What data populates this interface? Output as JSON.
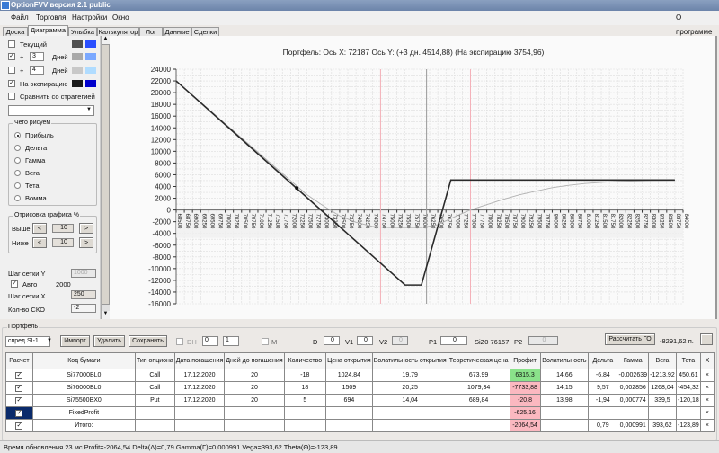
{
  "window": {
    "title": "OptionFVV версия 2.1 public"
  },
  "menu": [
    "Файл",
    "Торговля",
    "Настройки",
    "Окно"
  ],
  "menu_right": "О программе",
  "tabs": [
    "Доска",
    "Диаграмма",
    "Улыбка",
    "Калькулятор",
    "Лог",
    "Данные",
    "Сделки"
  ],
  "active_tab": "Диаграмма",
  "left_panel": {
    "current": {
      "label": "Текущий",
      "checked": false,
      "colors": [
        "#505050",
        "#2a4fff"
      ]
    },
    "plus1": {
      "prefix": "+",
      "days": "3",
      "unit": "Дней",
      "checked": true,
      "colors": [
        "#a8a8a8",
        "#7aa8ff"
      ]
    },
    "plus2": {
      "prefix": "+",
      "days": "4",
      "unit": "Дней",
      "checked": false,
      "colors": [
        "#c8c8c8",
        "#b0dcff"
      ]
    },
    "expiry": {
      "label": "На экспирацию",
      "checked": true,
      "colors": [
        "#1a1a1a",
        "#0000cc"
      ]
    },
    "compare": {
      "label": "Сравнить со стратегией",
      "checked": false
    },
    "strategy_select": "",
    "draw_group": {
      "title": "Чего рисуем",
      "options": [
        "Прибыль",
        "Дельта",
        "Гамма",
        "Вега",
        "Тета",
        "Вомма"
      ],
      "selected": "Прибыль"
    },
    "range_group": {
      "title": "Отрисовка графика %",
      "above_label": "Выше",
      "above": "10",
      "below_label": "Ниже",
      "below": "10",
      "dec": "<",
      "inc": ">"
    },
    "grid_y_label": "Шаг сетки Y",
    "grid_y": "1000",
    "auto_label": "Авто",
    "auto_checked": true,
    "auto_value": "2000",
    "grid_x_label": "Шаг сетки X",
    "grid_x": "250",
    "sko_label": "Кол-во СКО",
    "sko": "-2"
  },
  "chart_data": {
    "type": "line",
    "title": "Портфель: Ось X: 72187 Ось Y:  (+3 дн. 4514,88)  (На экспирацию 3754,96)",
    "xlim": [
      68500,
      84000
    ],
    "xtick_step": 250,
    "ylim": [
      -16000,
      24000
    ],
    "ytick_step": 2000,
    "grid": true,
    "series": [
      {
        "color": "#b0b0b0",
        "points": [
          [
            68500,
            22000
          ],
          [
            72000,
            5000
          ],
          [
            72500,
            2600
          ],
          [
            73000,
            700
          ],
          [
            73500,
            -1000
          ],
          [
            74000,
            -2100
          ],
          [
            74500,
            -2800
          ],
          [
            75000,
            -3000
          ],
          [
            75500,
            -3000
          ],
          [
            76000,
            -3000
          ],
          [
            76500,
            -2500
          ],
          [
            77000,
            -1200
          ],
          [
            77500,
            0
          ],
          [
            78000,
            900
          ],
          [
            78500,
            1800
          ],
          [
            79000,
            2600
          ],
          [
            79500,
            3200
          ],
          [
            80000,
            3800
          ],
          [
            80500,
            4200
          ],
          [
            81000,
            4500
          ],
          [
            81500,
            4700
          ],
          [
            82000,
            4850
          ],
          [
            83000,
            5000
          ],
          [
            83750,
            5050
          ]
        ]
      },
      {
        "color": "#2a2a2a",
        "points": [
          [
            68500,
            22000
          ],
          [
            75500,
            -12800
          ],
          [
            76000,
            -12800
          ],
          [
            76900,
            5100
          ],
          [
            83750,
            5100
          ]
        ]
      }
    ],
    "vlines": [
      {
        "x": 74750,
        "color": "#f4b0b8"
      },
      {
        "x": 77500,
        "color": "#f4b0b8"
      },
      {
        "x": 76157,
        "color": "#999999"
      }
    ],
    "marker": {
      "x": 72187,
      "y": 3754.96
    }
  },
  "portfolio": {
    "title": "Портфель",
    "select": "спред SI-1",
    "import": "Импорт",
    "delete": "Удалить",
    "save": "Сохранить",
    "dh_label": "DH",
    "spin1": "0",
    "spin2": "1",
    "m_label": "M",
    "d_label": "D",
    "d": "0",
    "v1_label": "V1",
    "v1": "0",
    "v2_label": "V2",
    "v2": "0",
    "p1_label": "P1",
    "p1": "0",
    "future": "SiZ0 76157",
    "p2_label": "P2",
    "p2": "0",
    "calc_go": "Рассчитать ГО",
    "go_value": "-8291,62 п.",
    "minimize": "_",
    "columns": [
      "Расчет",
      "Код бумаги",
      "Тип опциона",
      "Дата погашения",
      "Дней до погашения",
      "Количество",
      "Цена открытия",
      "Волатильность открытия",
      "Теоретическая цена",
      "Профит",
      "Волатильность",
      "Дельта",
      "Гамма",
      "Вега",
      "Тета",
      "X"
    ],
    "rows": [
      [
        "✓",
        "Si77000BL0",
        "Call",
        "17.12.2020",
        "20",
        "-18",
        "1024,84",
        "19,79",
        "673,99",
        "6315,3",
        "14,66",
        "-6,84",
        "-0,002639",
        "-1213,92",
        "450,61",
        "×"
      ],
      [
        "✓",
        "Si76000BL0",
        "Call",
        "17.12.2020",
        "20",
        "18",
        "1509",
        "20,25",
        "1079,34",
        "-7733,88",
        "14,15",
        "9,57",
        "0,002856",
        "1268,04",
        "-454,32",
        "×"
      ],
      [
        "✓",
        "Si75500BX0",
        "Put",
        "17.12.2020",
        "20",
        "5",
        "694",
        "14,04",
        "689,84",
        "-20,8",
        "13,98",
        "-1,94",
        "0,000774",
        "339,5",
        "-120,18",
        "×"
      ],
      [
        "✓",
        "FixedProfit",
        "",
        "",
        "",
        "",
        "",
        "",
        "",
        "-625,16",
        "",
        "",
        "",
        "",
        "",
        "×"
      ],
      [
        "✓",
        "Итого:",
        "",
        "",
        "",
        "",
        "",
        "",
        "",
        "-2064,54",
        "",
        "0,79",
        "0,000991",
        "393,62",
        "-123,89",
        "×"
      ]
    ],
    "profit_colors": {
      "positive": "#8ae28a",
      "negative": "#fbb8c0"
    }
  },
  "status": "Время обновления 23 мс  Profit=-2064,54 Delta(Δ)=0,79 Gamma(Γ)=0,000991 Vega=393,62 Theta(Θ)=-123,89"
}
